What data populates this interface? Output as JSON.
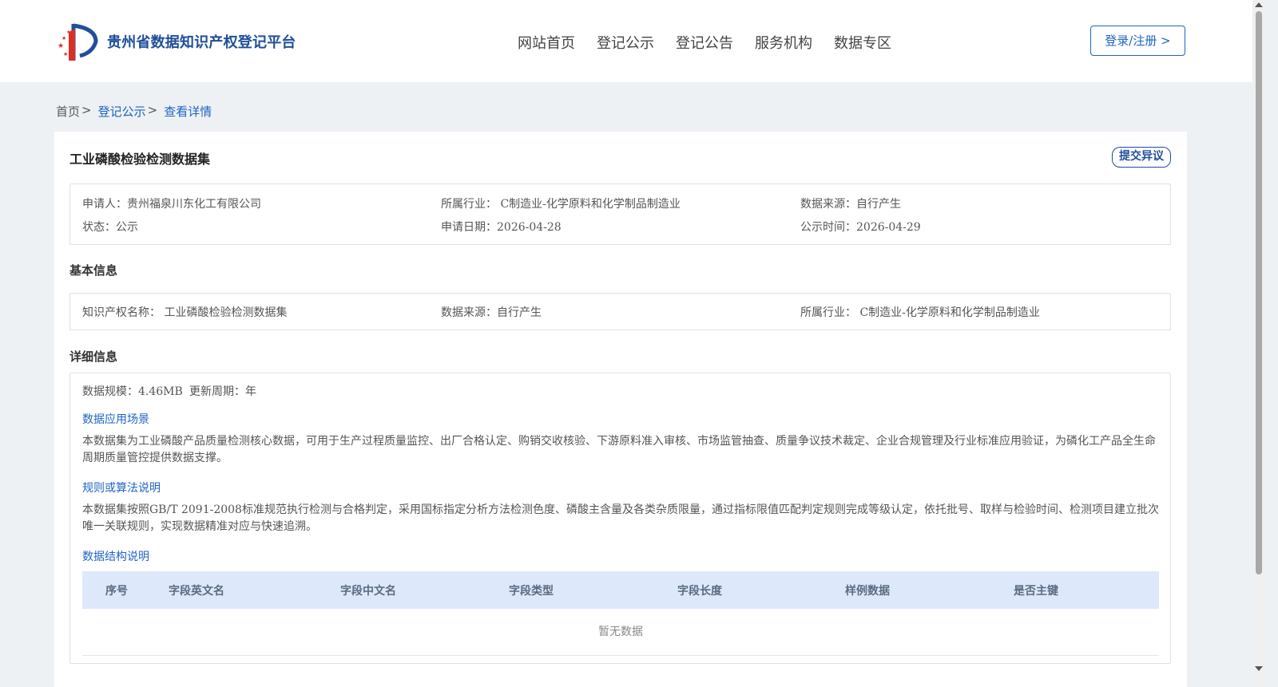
{
  "header": {
    "logo_text": "贵州省数据知识产权登记平台",
    "nav": [
      "网站首页",
      "登记公示",
      "登记公告",
      "服务机构",
      "数据专区"
    ],
    "login_label": "登录/注册 >"
  },
  "breadcrumb": {
    "home": "首页",
    "sep": ">",
    "level1": "登记公示",
    "current": "查看详情"
  },
  "detail": {
    "title": "工业磷酸检验检测数据集",
    "objection_label": "提交异议",
    "summary": {
      "applicant": "申请人：贵州福泉川东化工有限公司",
      "industry": "所属行业： C制造业-化学原料和化学制品制造业",
      "source": "数据来源：自行产生",
      "status": "状态：公示",
      "apply_date": "申请日期：2026-04-28",
      "publish_time": "公示时间：2026-04-29"
    },
    "basic_info": {
      "heading": "基本信息",
      "name": "知识产权名称： 工业磷酸检验检测数据集",
      "source": "数据来源：自行产生",
      "industry": "所属行业： C制造业-化学原料和化学制品制造业"
    },
    "detail_info": {
      "heading": "详细信息",
      "scale": "数据规模：4.46MB",
      "cycle": "更新周期：年",
      "scenario_heading": "数据应用场景",
      "scenario_text": "本数据集为工业磷酸产品质量检测核心数据，可用于生产过程质量监控、出厂合格认定、购销交收核验、下游原料准入审核、市场监管抽查、质量争议技术裁定、企业合规管理及行业标准应用验证，为磷化工产品全生命周期质量管控提供数据支撑。",
      "rules_heading": "规则或算法说明",
      "rules_text": "本数据集按照GB/T 2091-2008标准规范执行检测与合格判定，采用国标指定分析方法检测色度、磷酸主含量及各类杂质限量，通过指标限值匹配判定规则完成等级认定，依托批号、取样与检验时间、检测项目建立批次唯一关联规则，实现数据精准对应与快速追溯。",
      "structure_heading": "数据结构说明",
      "table_headers": [
        "序号",
        "字段英文名",
        "字段中文名",
        "字段类型",
        "字段长度",
        "样例数据",
        "是否主键"
      ],
      "empty_text": "暂无数据"
    }
  },
  "colors": {
    "brand": "#1f4e9b",
    "link": "#1f64c4",
    "table_header_bg": "#dde9fb",
    "page_bg": "#eef1f4"
  }
}
